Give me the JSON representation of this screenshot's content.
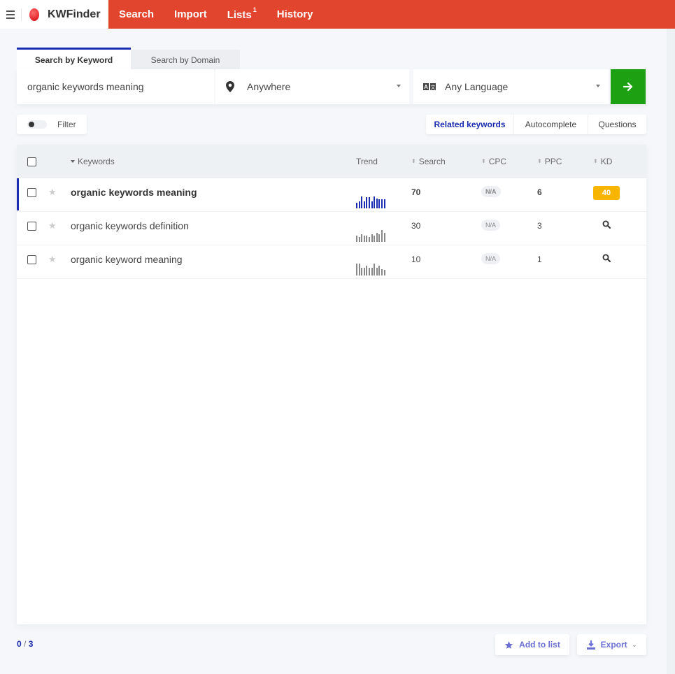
{
  "app": {
    "brand": "KWFinder",
    "nav": [
      {
        "label": "Search"
      },
      {
        "label": "Import"
      },
      {
        "label": "Lists",
        "badge": "1"
      },
      {
        "label": "History"
      }
    ]
  },
  "search": {
    "tabs": [
      {
        "label": "Search by Keyword",
        "active": true
      },
      {
        "label": "Search by Domain",
        "active": false
      }
    ],
    "keyword_value": "organic keywords meaning",
    "location": "Anywhere",
    "language": "Any Language",
    "go_icon": "arrow-right-icon"
  },
  "filter": {
    "label": "Filter",
    "enabled": false
  },
  "modes": [
    {
      "label": "Related keywords",
      "active": true
    },
    {
      "label": "Autocomplete",
      "active": false
    },
    {
      "label": "Questions",
      "active": false
    }
  ],
  "table": {
    "columns": {
      "keywords": "Keywords",
      "trend": "Trend",
      "search": "Search",
      "cpc": "CPC",
      "ppc": "PPC",
      "kd": "KD"
    },
    "rows": [
      {
        "keyword": "organic keywords meaning",
        "selected": true,
        "search": "70",
        "cpc": "N/A",
        "ppc": "6",
        "kd": "40",
        "trend": [
          0.45,
          0.6,
          1.0,
          0.6,
          0.95,
          0.95,
          0.6,
          1.0,
          0.85,
          0.75,
          0.75,
          0.75
        ]
      },
      {
        "keyword": "organic keywords definition",
        "selected": false,
        "search": "30",
        "cpc": "N/A",
        "ppc": "3",
        "kd": null,
        "trend": [
          0.55,
          0.4,
          0.65,
          0.55,
          0.55,
          0.4,
          0.65,
          0.55,
          0.75,
          0.65,
          1.0,
          0.75
        ]
      },
      {
        "keyword": "organic keyword meaning",
        "selected": false,
        "search": "10",
        "cpc": "N/A",
        "ppc": "1",
        "kd": null,
        "trend": [
          1.0,
          1.0,
          0.65,
          0.65,
          0.85,
          0.65,
          0.65,
          1.0,
          0.65,
          0.85,
          0.55,
          0.45
        ]
      }
    ]
  },
  "footer": {
    "selected": "0",
    "separator": "/",
    "total": "3",
    "add_to_list": "Add to list",
    "export": "Export"
  },
  "colors": {
    "brand_red": "#e2452e",
    "accent_blue": "#1b2db0",
    "go_green": "#1ea013",
    "kd_badge": "#f7b500",
    "trend_selected": "#1b2db0",
    "trend_default": "#888888",
    "footer_button": "#6b6fd4"
  }
}
